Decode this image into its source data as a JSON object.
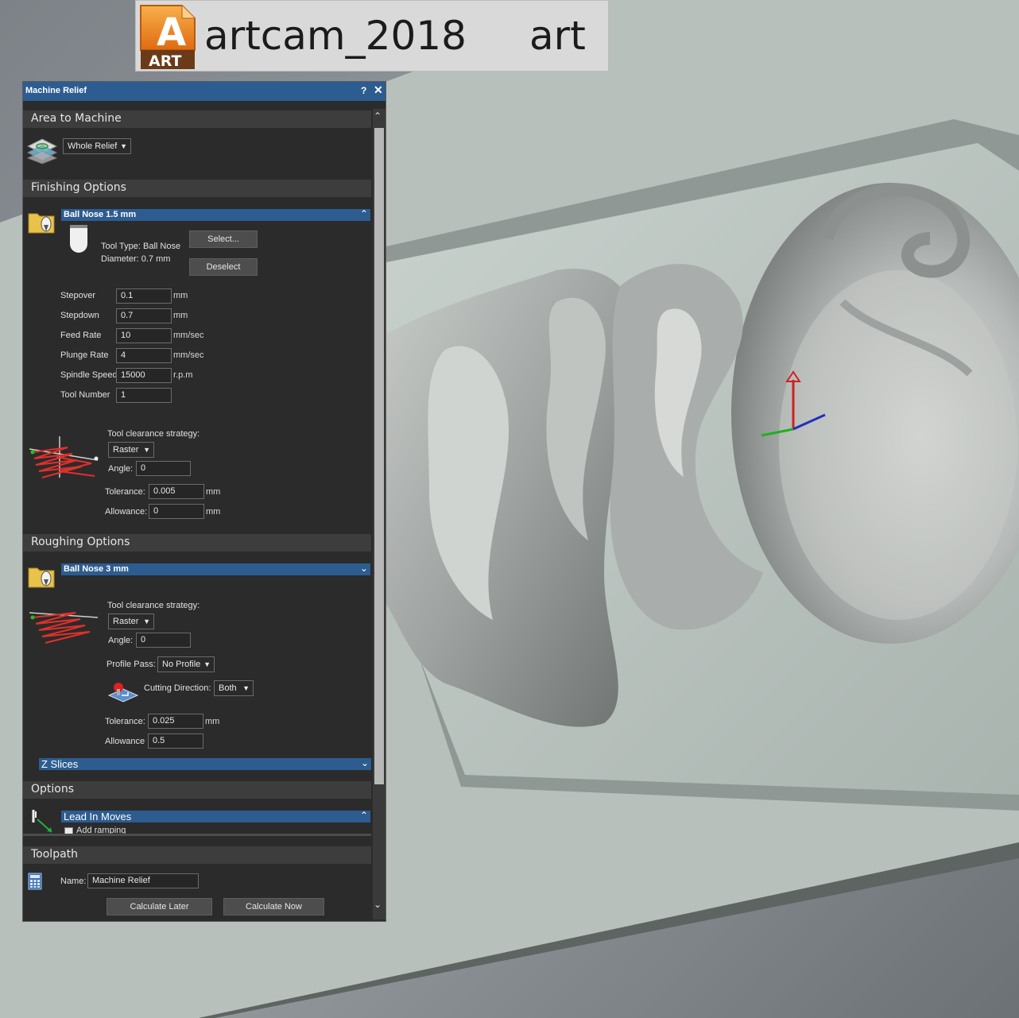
{
  "banner": {
    "logo_text": "ART",
    "title": "artcam_2018",
    "suffix": "art"
  },
  "panel": {
    "title": "Machine Relief",
    "help_glyph": "?",
    "close_glyph": "✕",
    "area_to_machine": {
      "header": "Area to Machine",
      "selection": "Whole Relief"
    },
    "finishing": {
      "header": "Finishing Options",
      "tool_name": "Ball Nose 1.5 mm",
      "tool_type": "Tool Type: Ball Nose",
      "diameter": "Diameter:  0.7 mm",
      "select_label": "Select...",
      "deselect_label": "Deselect",
      "params": [
        {
          "label": "Stepover",
          "value": "0.1",
          "unit": "mm"
        },
        {
          "label": "Stepdown",
          "value": "0.7",
          "unit": "mm"
        },
        {
          "label": "Feed Rate",
          "value": "10",
          "unit": "mm/sec"
        },
        {
          "label": "Plunge Rate",
          "value": "4",
          "unit": "mm/sec"
        },
        {
          "label": "Spindle Speed",
          "value": "15000",
          "unit": "r.p.m"
        },
        {
          "label": "Tool Number",
          "value": "1",
          "unit": ""
        }
      ],
      "strategy_label": "Tool clearance strategy:",
      "strategy": "Raster",
      "angle_label": "Angle:",
      "angle": "0",
      "tolerance_label": "Tolerance:",
      "tolerance": "0.005",
      "tolerance_unit": "mm",
      "allowance_label": "Allowance:",
      "allowance": "0",
      "allowance_unit": "mm"
    },
    "roughing": {
      "header": "Roughing Options",
      "tool_name": "Ball Nose 3 mm",
      "strategy_label": "Tool clearance strategy:",
      "strategy": "Raster",
      "angle_label": "Angle:",
      "angle": "0",
      "profile_label": "Profile Pass:",
      "profile": "No Profile",
      "cutting_label": "Cutting Direction:",
      "cutting": "Both",
      "tolerance_label": "Tolerance:",
      "tolerance": "0.025",
      "tolerance_unit": "mm",
      "allowance_label": "Allowance",
      "allowance": "0.5"
    },
    "z_slices": "Z Slices",
    "options": {
      "header": "Options",
      "lead_in": "Lead In Moves",
      "add_ramping": "Add ramping"
    },
    "toolpath": {
      "header": "Toolpath",
      "name_label": "Name:",
      "name": "Machine Relief",
      "calc_later": "Calculate Later",
      "calc_now": "Calculate Now"
    }
  },
  "colors": {
    "panel_bg": "#2b2b2b",
    "accent_blue": "#2d5c90",
    "section_header": "#3d3d3d"
  }
}
